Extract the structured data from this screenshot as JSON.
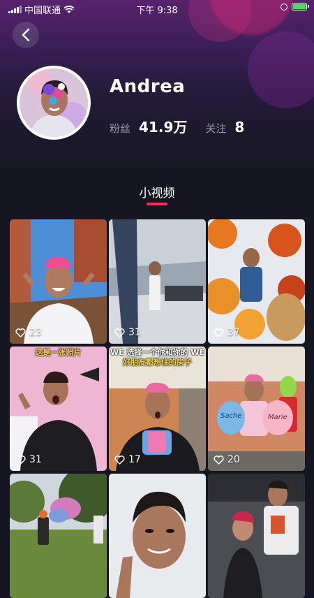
{
  "status_bar": {
    "carrier": "中国联通",
    "time": "下午 9:38"
  },
  "profile": {
    "name": "Andrea",
    "followers_label": "粉丝",
    "followers_value": "41.9万",
    "following_label": "关注",
    "following_value": "8"
  },
  "section": {
    "tab_label": "小视频"
  },
  "videos": [
    {
      "likes": "23"
    },
    {
      "likes": "31"
    },
    {
      "likes": "37"
    },
    {
      "likes": "31",
      "caption": "这是一张照片"
    },
    {
      "likes": "17",
      "caption_top": "WE 选择一个你和你的 WE",
      "caption_bottom": "好朋友都想住的房子"
    },
    {
      "likes": "20",
      "balloon_left": "Sache",
      "balloon_right": "Marie"
    },
    {},
    {},
    {}
  ],
  "colors": {
    "accent": "#fe2c55",
    "background": "#161622",
    "header_gradient_top": "#57236d"
  },
  "icons": [
    "back-icon",
    "wifi-icon",
    "signal-icon",
    "battery-icon",
    "heart-icon"
  ]
}
